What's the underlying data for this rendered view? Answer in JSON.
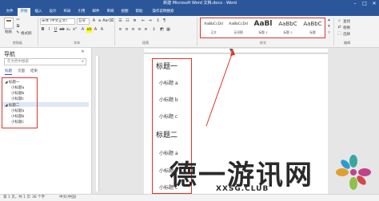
{
  "window": {
    "title": "新建 Microsoft Word 文档.docx - Word"
  },
  "tabs": [
    "文件",
    "开始",
    "插入",
    "设计",
    "布局",
    "引用",
    "邮件",
    "审阅",
    "视图",
    "帮助",
    "操作说明搜索"
  ],
  "active_tab": "开始",
  "ribbon": {
    "clipboard": {
      "paste": "粘贴",
      "format_painter": "格式刷",
      "label": "剪贴板"
    },
    "font": {
      "name": "宋体 (中文正文)",
      "size": "五号",
      "label": "字体"
    },
    "paragraph": {
      "label": "段落"
    },
    "styles": {
      "items": [
        {
          "preview": "AaBbCcDd",
          "name": "正文"
        },
        {
          "preview": "AaBbCcDd",
          "name": "无间隔"
        },
        {
          "preview": "AaBl",
          "name": "标题 1"
        },
        {
          "preview": "AaBbC",
          "name": "标题 2"
        },
        {
          "preview": "AaBbC",
          "name": "标题"
        }
      ],
      "label": "样式"
    },
    "editing": {
      "find": "查找",
      "replace": "替换",
      "select": "选择",
      "label": "编辑"
    }
  },
  "nav": {
    "title": "导航",
    "search_placeholder": "在文档中搜索",
    "tabs": [
      "标题",
      "页面",
      "结果"
    ],
    "tree": [
      {
        "label": "标题一",
        "children": [
          "小标题a",
          "小标题b",
          "小标题c"
        ]
      },
      {
        "label": "标题二",
        "children": [
          "小标题a",
          "小标题b",
          "小标题c"
        ]
      }
    ]
  },
  "document": {
    "blocks": [
      {
        "type": "h",
        "text": "标题一"
      },
      {
        "type": "sub",
        "text": "小标题 a"
      },
      {
        "type": "sub",
        "text": "小标题 b"
      },
      {
        "type": "sub",
        "text": "小标题 c"
      },
      {
        "type": "h",
        "text": "标题二"
      },
      {
        "type": "sub",
        "text": "小标题 a"
      },
      {
        "type": "sub",
        "text": "小标题 b"
      },
      {
        "type": "sub",
        "text": "小标题 c"
      }
    ]
  },
  "status": {
    "page": "第 1 页，共 1 页",
    "words": "36 个字",
    "lang": "中文(中国)"
  },
  "watermark": {
    "text": "德一游讯网",
    "url": "XXSG.CLUB"
  },
  "colors": {
    "accent": "#2b579a",
    "highlight": "#e2332b"
  },
  "icons": [
    "paste-icon",
    "format-painter-icon",
    "find-icon",
    "replace-icon",
    "select-icon",
    "close-icon",
    "minimize-icon",
    "maximize-icon"
  ]
}
